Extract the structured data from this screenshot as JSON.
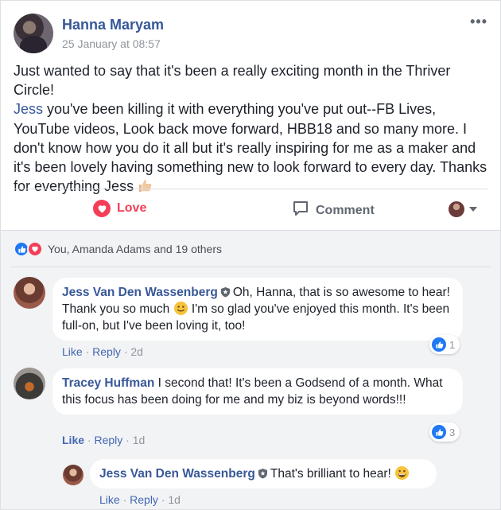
{
  "post": {
    "author": "Hanna Maryam",
    "timestamp": "25 January at 08:57",
    "more_label": "•••",
    "text_part1": "Just wanted to say that it's been a really exciting month in the Thriver Circle!",
    "mention": "Jess",
    "text_part2": " you've been killing it with everything you've put out--FB Lives, YouTube videos, Look back move forward, HBB18 and so many more. I don't know how you do it all but it's really inspiring for me as a maker and it's been lovely having something new to look forward to every day. Thanks for everything Jess"
  },
  "actions": {
    "love_label": "Love",
    "comment_label": "Comment"
  },
  "reactions": {
    "summary": "You, Amanda Adams and 19 others"
  },
  "comments": [
    {
      "name": "Jess Van Den Wassenberg",
      "text_a": "Oh, Hanna, that is so awesome to hear! Thank you so much",
      "text_b": " I'm so glad you've enjoyed this month. It's been full-on, but I've been loving it, too!",
      "like": "Like",
      "reply": "Reply",
      "age": "2d",
      "likes": "1"
    },
    {
      "name": "Tracey Huffman",
      "text": "I second that! It's been a Godsend of a month. What this focus has been doing for me and my biz is beyond words!!!",
      "like": "Like",
      "reply": "Reply",
      "age": "1d",
      "likes": "3"
    },
    {
      "name": "Jess Van Den Wassenberg",
      "text": "That's brilliant to hear!",
      "like": "Like",
      "reply": "Reply",
      "age": "1d"
    }
  ],
  "separator": "·",
  "colors": {
    "link": "#365899",
    "love": "#f33e58",
    "like_blue": "#2078f4",
    "muted": "#90949c",
    "background": "#f2f3f5"
  }
}
